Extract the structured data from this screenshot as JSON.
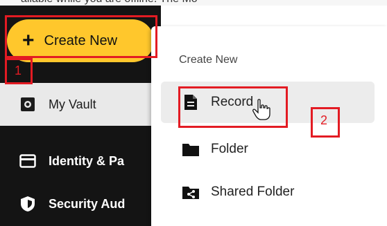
{
  "top_strip_text": "ailable while you are offline. The Mo",
  "sidebar": {
    "create_button": {
      "icon": "plus-icon",
      "label": "Create New"
    },
    "items": [
      {
        "icon": "vault-icon",
        "label": "My Vault",
        "active": true
      },
      {
        "icon": "card-icon",
        "label": "Identity & Pa",
        "active": false
      },
      {
        "icon": "shield-icon",
        "label": "Security Aud",
        "active": false
      }
    ]
  },
  "dropdown": {
    "header": "Create New",
    "items": [
      {
        "icon": "document-icon",
        "label": "Record"
      },
      {
        "icon": "folder-icon",
        "label": "Folder"
      },
      {
        "icon": "shared-folder-icon",
        "label": "Shared Folder"
      }
    ]
  },
  "annotations": {
    "step1": "1",
    "step2": "2",
    "color": "#e31b23"
  },
  "colors": {
    "accent": "#ffc72c",
    "sidebar_bg": "#141414",
    "active_item_bg": "#e9e9e9",
    "hover_item_bg": "#ececec"
  }
}
